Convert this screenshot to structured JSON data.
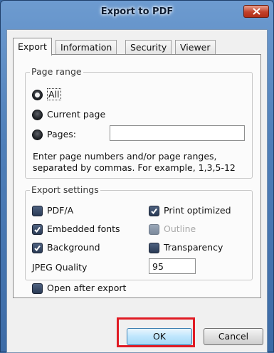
{
  "window": {
    "title": "Export to PDF",
    "close_glyph": "✕"
  },
  "tabs": [
    {
      "label": "Export",
      "active": true
    },
    {
      "label": "Information",
      "active": false
    },
    {
      "label": "Security",
      "active": false
    },
    {
      "label": "Viewer",
      "active": false
    }
  ],
  "page_range": {
    "legend": "Page range",
    "options": [
      {
        "label": "All",
        "selected": true
      },
      {
        "label": "Current page",
        "selected": false
      },
      {
        "label": "Pages:",
        "selected": false
      }
    ],
    "pages_value": "",
    "hint": "Enter page numbers and/or page ranges, separated by commas. For example, 1,3,5-12"
  },
  "export_settings": {
    "legend": "Export settings",
    "pdfa": {
      "label": "PDF/A",
      "checked": false
    },
    "embedded_fonts": {
      "label": "Embedded fonts",
      "checked": true
    },
    "background": {
      "label": "Background",
      "checked": true
    },
    "print_optimized": {
      "label": "Print optimized",
      "checked": true
    },
    "outline": {
      "label": "Outline",
      "checked": false,
      "disabled": true
    },
    "transparency": {
      "label": "Transparency",
      "checked": false
    },
    "jpeg_quality_label": "JPEG Quality",
    "jpeg_quality_value": "95"
  },
  "open_after_export": {
    "label": "Open after export",
    "checked": false
  },
  "buttons": {
    "ok": "OK",
    "cancel": "Cancel"
  },
  "colors": {
    "highlight": "#e01b24",
    "title_bar": "#4f7fb9"
  }
}
